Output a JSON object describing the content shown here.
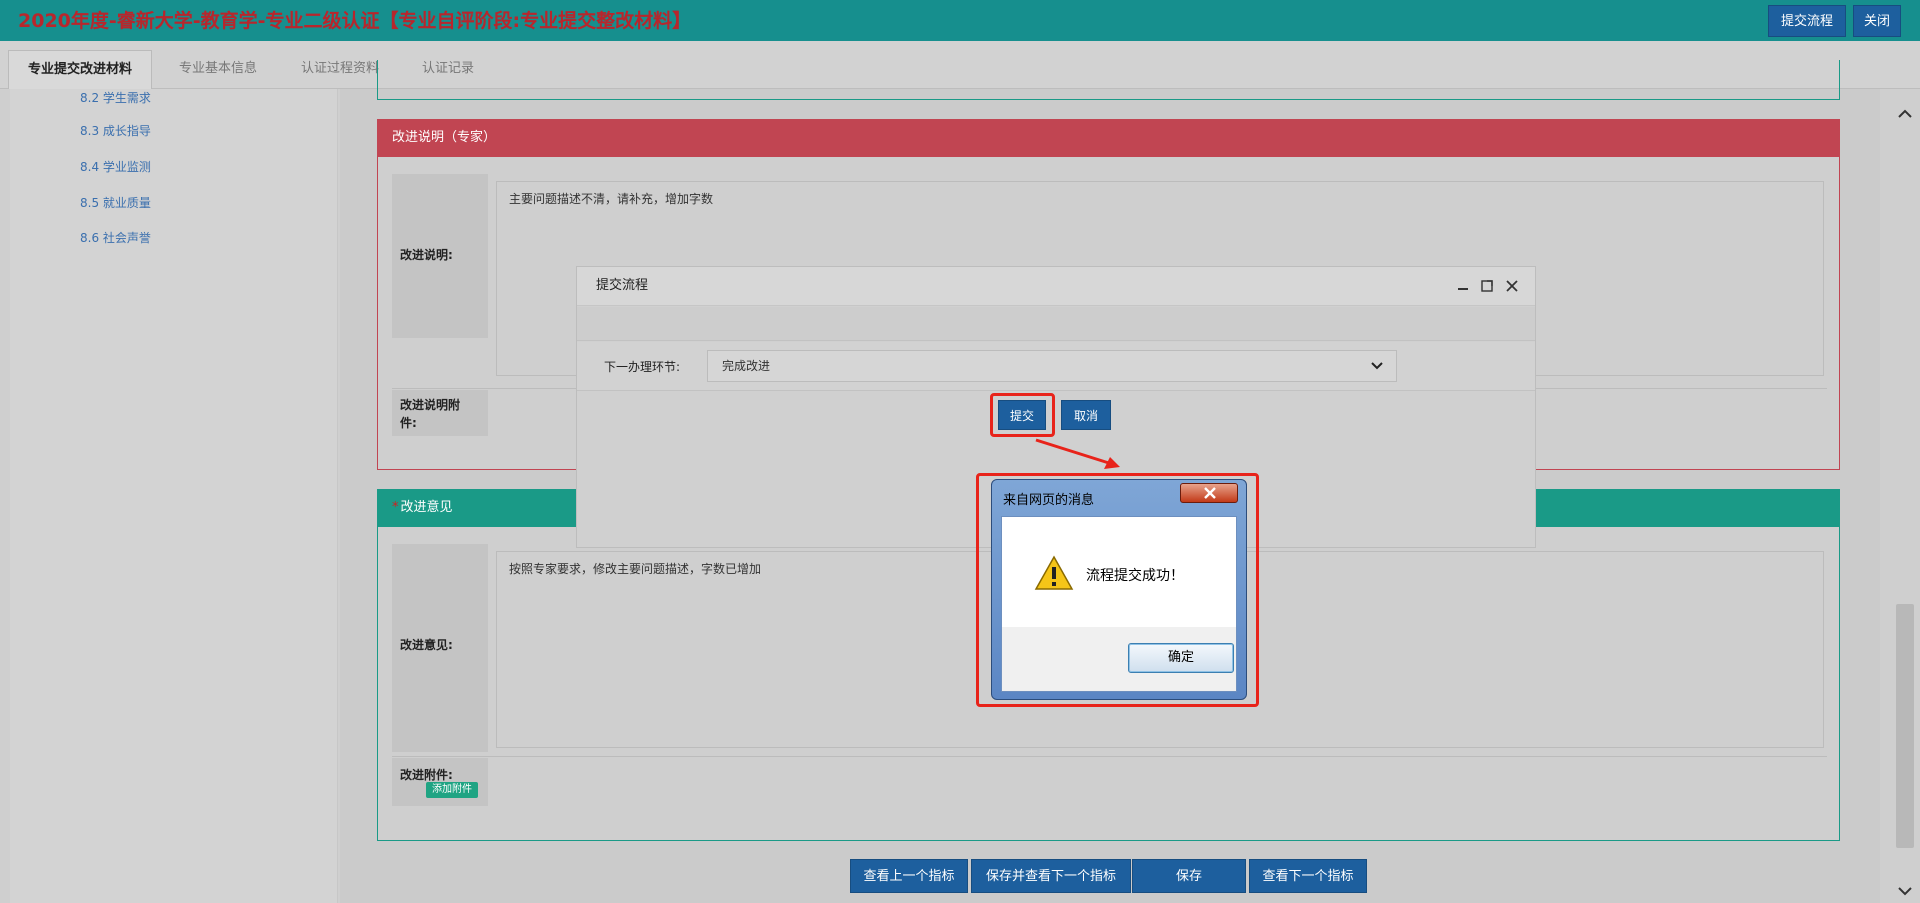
{
  "header": {
    "title": "2020年度-睿新大学-教育学-专业二级认证【专业自评阶段:专业提交整改材料】",
    "submit_flow_label": "提交流程",
    "close_label": "关闭"
  },
  "tabs": [
    {
      "label": "专业提交改进材料"
    },
    {
      "label": "专业基本信息"
    },
    {
      "label": "认证过程资料"
    },
    {
      "label": "认证记录"
    }
  ],
  "sidebar": {
    "items": [
      {
        "label": "8.2 学生需求"
      },
      {
        "label": "8.3 成长指导"
      },
      {
        "label": "8.4 学业监测"
      },
      {
        "label": "8.5 就业质量"
      },
      {
        "label": "8.6 社会声誉"
      }
    ]
  },
  "expert_panel": {
    "title": "改进说明（专家）",
    "desc_label": "改进说明:",
    "desc_text": "主要问题描述不清，请补充，增加字数",
    "attachment_label": "改进说明附件:"
  },
  "opinion_panel": {
    "required_mark": "*",
    "title": "改进意见",
    "opinion_label": "改进意见:",
    "opinion_text": "按照专家要求，修改主要问题描述，字数已增加",
    "attachment_label": "改进附件:",
    "add_attachment_label": "添加附件"
  },
  "bottom_buttons": {
    "prev_label": "查看上一个指标",
    "save_next_label": "保存并查看下一个指标",
    "save_label": "保存",
    "next_label": "查看下一个指标"
  },
  "modal": {
    "title": "提交流程",
    "next_step_label": "下一办理环节:",
    "next_step_value": "完成改进",
    "submit_label": "提交",
    "cancel_label": "取消"
  },
  "alert": {
    "title": "来自网页的消息",
    "message": "流程提交成功！",
    "ok_label": "确定"
  },
  "colors": {
    "header_bg": "#168f8e",
    "title_text": "#b8262c",
    "primary_button": "#1d5f9e",
    "panel_red": "#c14552",
    "panel_green": "#1a9a87",
    "highlight_red": "#e8231a"
  }
}
